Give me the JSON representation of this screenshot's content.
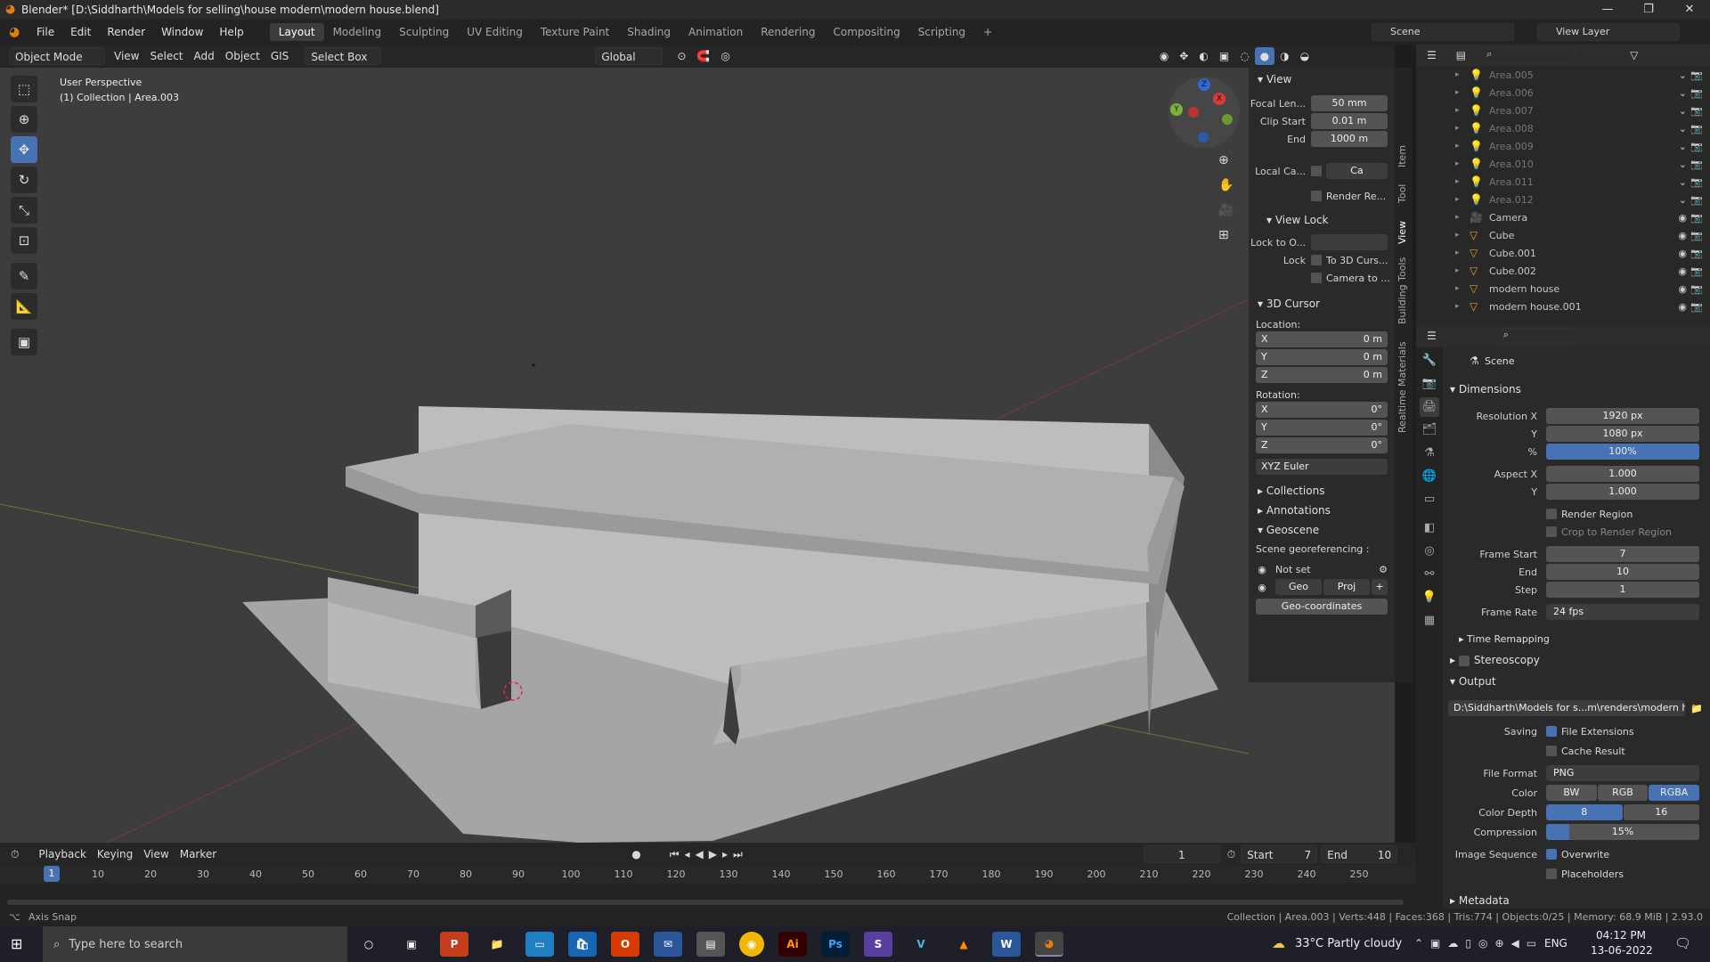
{
  "window": {
    "title": "Blender* [D:\\Siddharth\\Models for selling\\house modern\\modern house.blend]",
    "minimize": "—",
    "maximize": "❐",
    "close": "✕"
  },
  "menu": [
    "File",
    "Edit",
    "Render",
    "Window",
    "Help"
  ],
  "workspaces": [
    "Layout",
    "Modeling",
    "Sculpting",
    "UV Editing",
    "Texture Paint",
    "Shading",
    "Animation",
    "Rendering",
    "Compositing",
    "Scripting"
  ],
  "active_workspace": "Layout",
  "scene_name": "Scene",
  "view_layer": "View Layer",
  "viewport_header": {
    "mode": "Object Mode",
    "view": "View",
    "select": "Select",
    "add": "Add",
    "object": "Object",
    "gis": "GIS",
    "select_box": "Select Box",
    "orientation": "Global"
  },
  "overlay_text": {
    "perspective": "User Perspective",
    "collection": "(1) Collection | Area.003"
  },
  "npanel": {
    "tabs": [
      "Item",
      "Tool",
      "View",
      "Building Tools",
      "Realtime Materials"
    ],
    "active_tab": "View",
    "view": {
      "header": "View",
      "focal_label": "Focal Len...",
      "focal": "50 mm",
      "clip_start_label": "Clip Start",
      "clip_start": "0.01 m",
      "end_label": "End",
      "clip_end": "1000 m",
      "local_cam_label": "Local Ca...",
      "local_cam_value": "Ca",
      "render_region": "Render Re..."
    },
    "view_lock": {
      "header": "View Lock",
      "lock_obj_label": "Lock to O...",
      "lock_label": "Lock",
      "to_cursor": "To 3D Curs...",
      "camera_to": "Camera to ..."
    },
    "cursor": {
      "header": "3D Cursor",
      "location": "Location:",
      "rotation": "Rotation:",
      "x": "X",
      "y": "Y",
      "z": "Z",
      "lx": "0 m",
      "ly": "0 m",
      "lz": "0 m",
      "rx": "0°",
      "ry": "0°",
      "rz": "0°",
      "euler": "XYZ Euler"
    },
    "collections": "Collections",
    "annotations": "Annotations",
    "geoscene": {
      "header": "Geoscene",
      "georef": "Scene georeferencing :",
      "not_set": "Not set",
      "geo": "Geo",
      "proj": "Proj",
      "plus": "+",
      "geo_coords": "Geo-coordinates"
    }
  },
  "outliner": [
    {
      "name": "Area.005",
      "type": "light",
      "dim": true
    },
    {
      "name": "Area.006",
      "type": "light",
      "dim": true
    },
    {
      "name": "Area.007",
      "type": "light",
      "dim": true
    },
    {
      "name": "Area.008",
      "type": "light",
      "dim": true
    },
    {
      "name": "Area.009",
      "type": "light",
      "dim": true
    },
    {
      "name": "Area.010",
      "type": "light",
      "dim": true
    },
    {
      "name": "Area.011",
      "type": "light",
      "dim": true
    },
    {
      "name": "Area.012",
      "type": "light",
      "dim": true
    },
    {
      "name": "Camera",
      "type": "camera",
      "dim": false
    },
    {
      "name": "Cube",
      "type": "mesh",
      "dim": false
    },
    {
      "name": "Cube.001",
      "type": "mesh",
      "dim": false
    },
    {
      "name": "Cube.002",
      "type": "mesh",
      "dim": false
    },
    {
      "name": "modern house",
      "type": "mesh",
      "dim": false
    },
    {
      "name": "modern house.001",
      "type": "mesh",
      "dim": false
    }
  ],
  "properties": {
    "scene": "Scene",
    "dimensions": "Dimensions",
    "resolution_x_label": "Resolution X",
    "resolution_x": "1920 px",
    "y_label": "Y",
    "resolution_y": "1080 px",
    "percent_label": "%",
    "percent": "100%",
    "aspect_x_label": "Aspect X",
    "aspect_x": "1.000",
    "aspect_y": "1.000",
    "render_region": "Render Region",
    "crop": "Crop to Render Region",
    "frame_start_label": "Frame Start",
    "frame_start": "7",
    "end_label": "End",
    "frame_end": "10",
    "step_label": "Step",
    "step": "1",
    "frame_rate_label": "Frame Rate",
    "frame_rate": "24 fps",
    "time_remapping": "Time Remapping",
    "stereoscopy": "Stereoscopy",
    "output": "Output",
    "output_path": "D:\\Siddharth\\Models for s...m\\renders\\modern house",
    "saving_label": "Saving",
    "file_ext": "File Extensions",
    "cache": "Cache Result",
    "file_format_label": "File Format",
    "file_format": "PNG",
    "color_label": "Color",
    "bw": "BW",
    "rgb": "RGB",
    "rgba": "RGBA",
    "depth_label": "Color Depth",
    "depth8": "8",
    "depth16": "16",
    "compression_label": "Compression",
    "compression": "15%",
    "compression_value": 0.15,
    "image_seq_label": "Image Sequence",
    "overwrite": "Overwrite",
    "placeholders": "Placeholders",
    "metadata": "Metadata"
  },
  "timeline": {
    "playback": "Playback",
    "keying": "Keying",
    "view": "View",
    "marker": "Marker",
    "current_frame": "1",
    "start_label": "Start",
    "start": "7",
    "end_label": "End",
    "end": "10",
    "ticks": [
      "10",
      "20",
      "30",
      "40",
      "50",
      "60",
      "70",
      "80",
      "90",
      "100",
      "110",
      "120",
      "130",
      "140",
      "150",
      "160",
      "170",
      "180",
      "190",
      "200",
      "210",
      "220",
      "230",
      "240",
      "250"
    ],
    "playhead": "1"
  },
  "status": {
    "left": "Axis Snap",
    "right": "Collection | Area.003 | Verts:448 | Faces:368 | Tris:774 | Objects:0/25 | Memory: 68.9 MiB | 2.93.0"
  },
  "taskbar": {
    "search_placeholder": "Type here to search",
    "weather": "33°C  Partly cloudy",
    "lang": "ENG",
    "time": "04:12 PM",
    "date": "13-06-2022"
  }
}
